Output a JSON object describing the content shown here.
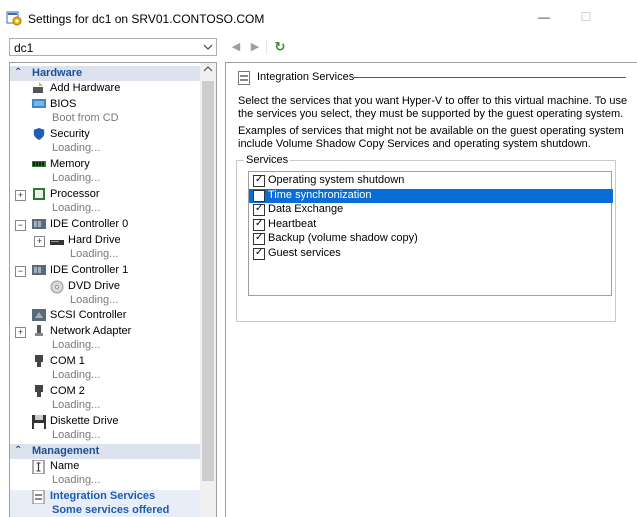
{
  "window": {
    "title": "Settings for dc1 on SRV01.CONTOSO.COM",
    "minimize_glyph": "—",
    "maximize_glyph": "☐"
  },
  "toolbar": {
    "vm_selected": "dc1",
    "back_glyph": "◀",
    "forward_glyph": "▶",
    "refresh_glyph": "↻",
    "refresh_color": "#2e8b2e"
  },
  "sidebar": {
    "hardware_header": "Hardware",
    "management_header": "Management",
    "items": {
      "add_hardware": {
        "label": "Add Hardware"
      },
      "bios": {
        "label": "BIOS",
        "sub": "Boot from CD"
      },
      "security": {
        "label": "Security",
        "sub": "Loading..."
      },
      "memory": {
        "label": "Memory",
        "sub": "Loading..."
      },
      "processor": {
        "label": "Processor",
        "sub": "Loading..."
      },
      "ide0": {
        "label": "IDE Controller 0"
      },
      "hard_drive": {
        "label": "Hard Drive",
        "sub": "Loading..."
      },
      "ide1": {
        "label": "IDE Controller 1"
      },
      "dvd_drive": {
        "label": "DVD Drive",
        "sub": "Loading..."
      },
      "scsi": {
        "label": "SCSI Controller"
      },
      "network": {
        "label": "Network Adapter",
        "sub": "Loading..."
      },
      "com1": {
        "label": "COM 1",
        "sub": "Loading..."
      },
      "com2": {
        "label": "COM 2",
        "sub": "Loading..."
      },
      "diskette": {
        "label": "Diskette Drive",
        "sub": "Loading..."
      },
      "name": {
        "label": "Name",
        "sub": "Loading..."
      },
      "integration": {
        "label": "Integration Services",
        "sub": "Some services offered"
      }
    }
  },
  "main": {
    "title": "Integration Services",
    "para1": "Select the services that you want Hyper-V to offer to this virtual machine. To use the services you select, they must be supported by the guest operating system.",
    "para2": "Examples of services that might not be available on the guest operating system include Volume Shadow Copy Services and operating system shutdown.",
    "services_label": "Services",
    "services": [
      {
        "label": "Operating system shutdown",
        "checked": true,
        "selected": false
      },
      {
        "label": "Time synchronization",
        "checked": false,
        "selected": true
      },
      {
        "label": "Data Exchange",
        "checked": true,
        "selected": false
      },
      {
        "label": "Heartbeat",
        "checked": true,
        "selected": false
      },
      {
        "label": "Backup (volume shadow copy)",
        "checked": true,
        "selected": false
      },
      {
        "label": "Guest services",
        "checked": true,
        "selected": false
      }
    ],
    "check_glyph": "✓"
  },
  "colors": {
    "accent_blue": "#1c4e9a",
    "selection_blue": "#0a6cd6",
    "section_header_bg": "#dde3ee"
  }
}
